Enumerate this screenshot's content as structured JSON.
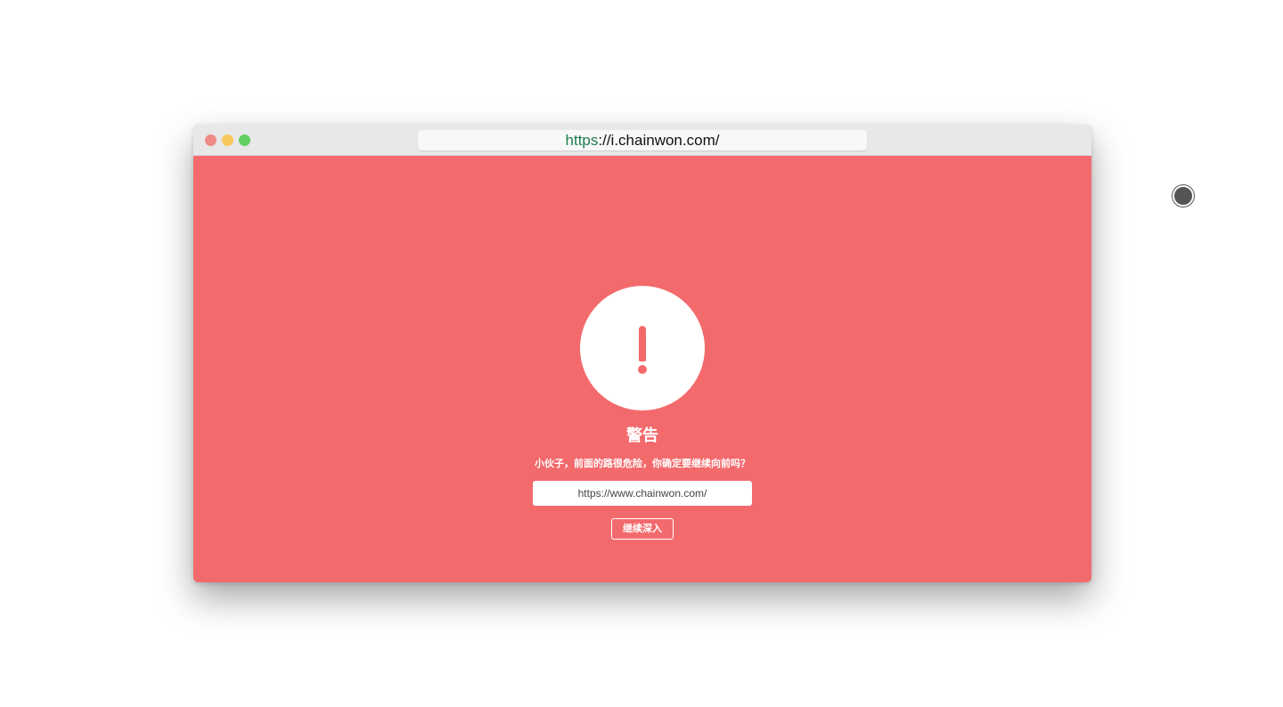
{
  "browser": {
    "url_scheme": "https",
    "url_rest": "://i.chainwon.com/",
    "traffic_lights": {
      "close_color": "#f08a84",
      "minimize_color": "#f7c95e",
      "maximize_color": "#63cf62"
    }
  },
  "page": {
    "background_color": "#f36a6c",
    "icon": "exclamation-icon",
    "title": "警告",
    "message": "小伙子，前面的路很危险，你确定要继续向前吗？",
    "target_url": "https://www.chainwon.com/",
    "continue_label": "继续深入"
  },
  "pointer": {
    "icon": "cursor-circle-icon"
  }
}
